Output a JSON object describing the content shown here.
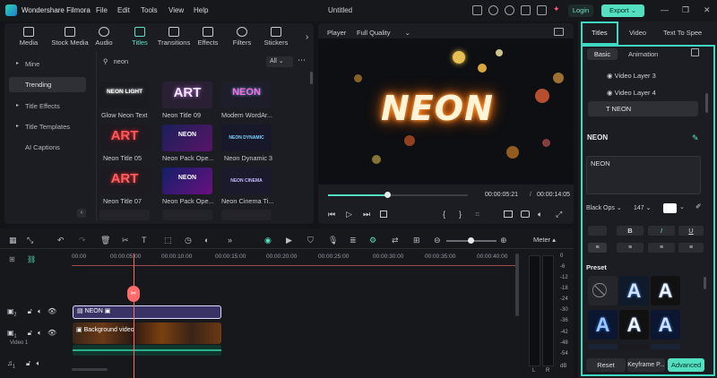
{
  "app": {
    "name": "Wondershare Filmora",
    "doc_title": "Untitled",
    "menu": [
      "File",
      "Edit",
      "Tools",
      "View",
      "Help"
    ],
    "login_label": "Login",
    "export_label": "Export"
  },
  "media_tabs": [
    {
      "label": "Media"
    },
    {
      "label": "Stock Media"
    },
    {
      "label": "Audio"
    },
    {
      "label": "Titles"
    },
    {
      "label": "Transitions"
    },
    {
      "label": "Effects"
    },
    {
      "label": "Filters"
    },
    {
      "label": "Stickers"
    }
  ],
  "sidebar": {
    "items": [
      {
        "label": "Mine"
      },
      {
        "label": "Trending"
      },
      {
        "label": "Title Effects"
      },
      {
        "label": "Title Templates"
      },
      {
        "label": "AI Captions"
      }
    ]
  },
  "search": {
    "value": "neon",
    "filter": "All"
  },
  "thumbnails": [
    {
      "label": "Glow Neon Text",
      "art": "NEON LIGHT"
    },
    {
      "label": "Neon Title 09",
      "art": "ART"
    },
    {
      "label": "Modern WordAr...",
      "art": "NEON"
    },
    {
      "label": "Neon Title 05",
      "art": "ART"
    },
    {
      "label": "Neon Pack Ope...",
      "art": "NEON"
    },
    {
      "label": "Neon Dynamic 3",
      "art": "NEON DYNAMIC"
    },
    {
      "label": "Neon Title 07",
      "art": "ART"
    },
    {
      "label": "Neon Pack Ope...",
      "art": "NEON"
    },
    {
      "label": "Neon Cinema Ti...",
      "art": "NEON CINEMA"
    }
  ],
  "player": {
    "label": "Player",
    "quality": "Full Quality",
    "overlay_text": "NEON",
    "current_time": "00:00:05:21",
    "total_time": "00:00:14:05",
    "progress": 0.42
  },
  "right_panel": {
    "tabs": [
      "Titles",
      "Video",
      "Text To Spee"
    ],
    "subtabs": [
      "Basic",
      "Animation"
    ],
    "layers": [
      "Video Layer 3",
      "Video Layer 4",
      "NEON"
    ],
    "section_title": "NEON",
    "text_value": "NEON",
    "font": "Black Ops",
    "font_size": "147",
    "preset_label": "Preset",
    "reset_label": "Reset",
    "keyframe_label": "Keyframe P...",
    "advanced_label": "Advanced"
  },
  "timeline": {
    "ruler": [
      "00:00",
      "00:00:05:00",
      "00:00:10:00",
      "00:00:15:00",
      "00:00:20:00",
      "00:00:25:00",
      "00:00:30:00",
      "00:00:35:00",
      "00:00:40:00"
    ],
    "meter_label": "Meter",
    "meter_scale": [
      "0",
      "-6",
      "-12",
      "-18",
      "-24",
      "-30",
      "-36",
      "-42",
      "-48",
      "-54",
      "dB"
    ],
    "meter_channels": [
      "L",
      "R"
    ],
    "clips": [
      {
        "label": "NEON"
      },
      {
        "label": "Background video"
      }
    ],
    "track_label": "Video 1"
  }
}
